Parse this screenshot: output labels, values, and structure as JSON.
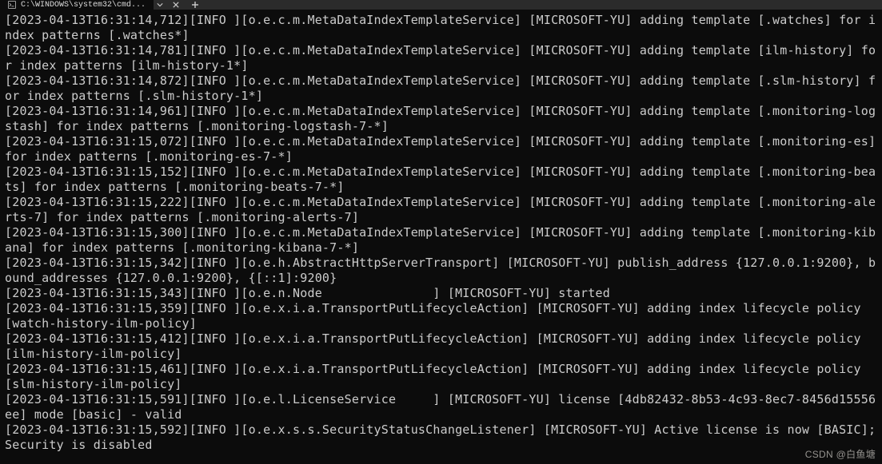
{
  "tab": {
    "title": "C:\\WINDOWS\\system32\\cmd..."
  },
  "watermark": "CSDN @白鱼塘",
  "log_lines": [
    "[2023-04-13T16:31:14,712][INFO ][o.e.c.m.MetaDataIndexTemplateService] [MICROSOFT-YU] adding template [.watches] for index patterns [.watches*]",
    "[2023-04-13T16:31:14,781][INFO ][o.e.c.m.MetaDataIndexTemplateService] [MICROSOFT-YU] adding template [ilm-history] for index patterns [ilm-history-1*]",
    "[2023-04-13T16:31:14,872][INFO ][o.e.c.m.MetaDataIndexTemplateService] [MICROSOFT-YU] adding template [.slm-history] for index patterns [.slm-history-1*]",
    "[2023-04-13T16:31:14,961][INFO ][o.e.c.m.MetaDataIndexTemplateService] [MICROSOFT-YU] adding template [.monitoring-logstash] for index patterns [.monitoring-logstash-7-*]",
    "[2023-04-13T16:31:15,072][INFO ][o.e.c.m.MetaDataIndexTemplateService] [MICROSOFT-YU] adding template [.monitoring-es] for index patterns [.monitoring-es-7-*]",
    "[2023-04-13T16:31:15,152][INFO ][o.e.c.m.MetaDataIndexTemplateService] [MICROSOFT-YU] adding template [.monitoring-beats] for index patterns [.monitoring-beats-7-*]",
    "[2023-04-13T16:31:15,222][INFO ][o.e.c.m.MetaDataIndexTemplateService] [MICROSOFT-YU] adding template [.monitoring-alerts-7] for index patterns [.monitoring-alerts-7]",
    "[2023-04-13T16:31:15,300][INFO ][o.e.c.m.MetaDataIndexTemplateService] [MICROSOFT-YU] adding template [.monitoring-kibana] for index patterns [.monitoring-kibana-7-*]",
    "[2023-04-13T16:31:15,342][INFO ][o.e.h.AbstractHttpServerTransport] [MICROSOFT-YU] publish_address {127.0.0.1:9200}, bound_addresses {127.0.0.1:9200}, {[::1]:9200}",
    "[2023-04-13T16:31:15,343][INFO ][o.e.n.Node               ] [MICROSOFT-YU] started",
    "[2023-04-13T16:31:15,359][INFO ][o.e.x.i.a.TransportPutLifecycleAction] [MICROSOFT-YU] adding index lifecycle policy [watch-history-ilm-policy]",
    "[2023-04-13T16:31:15,412][INFO ][o.e.x.i.a.TransportPutLifecycleAction] [MICROSOFT-YU] adding index lifecycle policy [ilm-history-ilm-policy]",
    "[2023-04-13T16:31:15,461][INFO ][o.e.x.i.a.TransportPutLifecycleAction] [MICROSOFT-YU] adding index lifecycle policy [slm-history-ilm-policy]",
    "[2023-04-13T16:31:15,591][INFO ][o.e.l.LicenseService     ] [MICROSOFT-YU] license [4db82432-8b53-4c93-8ec7-8456d15556ee] mode [basic] - valid",
    "[2023-04-13T16:31:15,592][INFO ][o.e.x.s.s.SecurityStatusChangeListener] [MICROSOFT-YU] Active license is now [BASIC]; Security is disabled"
  ]
}
